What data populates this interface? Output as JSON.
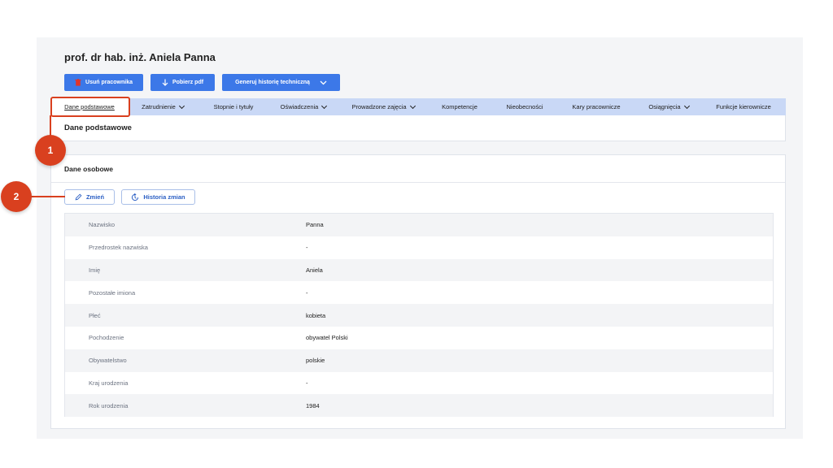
{
  "header": {
    "title": "prof. dr hab. inż. Aniela Panna"
  },
  "actions": {
    "delete_label": "Usuń pracownika",
    "pdf_label": "Pobierz pdf",
    "history_label": "Generuj historię techniczną"
  },
  "tabs": [
    {
      "label": "Dane podstawowe",
      "dropdown": false
    },
    {
      "label": "Zatrudnienie",
      "dropdown": true
    },
    {
      "label": "Stopnie i tytuły",
      "dropdown": false
    },
    {
      "label": "Oświadczenia",
      "dropdown": true
    },
    {
      "label": "Prowadzone zajęcia",
      "dropdown": true
    },
    {
      "label": "Kompetencje",
      "dropdown": false
    },
    {
      "label": "Nieobecności",
      "dropdown": false
    },
    {
      "label": "Kary pracownicze",
      "dropdown": false
    },
    {
      "label": "Osiągnięcia",
      "dropdown": true
    },
    {
      "label": "Funkcje kierownicze",
      "dropdown": false
    }
  ],
  "section": {
    "title": "Dane podstawowe"
  },
  "personal": {
    "title": "Dane osobowe",
    "edit_label": "Zmień",
    "history_label": "Historia zmian",
    "rows": [
      {
        "label": "Nazwisko",
        "value": "Panna"
      },
      {
        "label": "Przedrostek nazwiska",
        "value": "-"
      },
      {
        "label": "Imię",
        "value": "Aniela"
      },
      {
        "label": "Pozostałe imiona",
        "value": "-"
      },
      {
        "label": "Płeć",
        "value": "kobieta"
      },
      {
        "label": "Pochodzenie",
        "value": "obywatel Polski"
      },
      {
        "label": "Obywatelstwo",
        "value": "polskie"
      },
      {
        "label": "Kraj urodzenia",
        "value": "-"
      },
      {
        "label": "Rok urodzenia",
        "value": "1984"
      }
    ]
  },
  "annotations": {
    "marker1": "1",
    "marker2": "2"
  },
  "colors": {
    "primary": "#3c78e8",
    "tab_bar": "#c9d8f6",
    "annotation": "#d9401f",
    "delete_icon": "#e0342b"
  }
}
